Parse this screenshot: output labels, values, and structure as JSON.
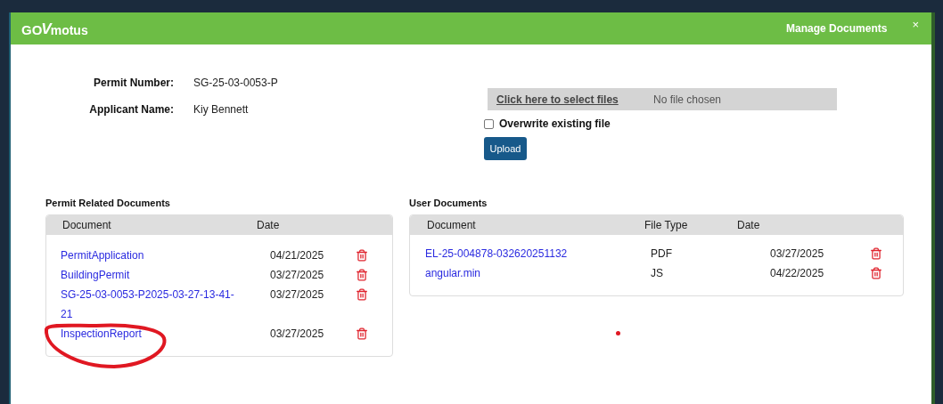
{
  "header": {
    "logo": {
      "prefix": "GO",
      "mark": "V",
      "suffix": "motus"
    },
    "title": "Manage Documents",
    "close": "×"
  },
  "permit_info": [
    {
      "label": "Permit Number:",
      "value": "SG-25-03-0053-P"
    },
    {
      "label": "Applicant Name:",
      "value": "Kiy Bennett"
    }
  ],
  "upload": {
    "select_link": "Click here to select files",
    "file_status": "No file chosen",
    "overwrite": {
      "label": "Overwrite existing file",
      "checked": false
    },
    "button": "Upload"
  },
  "permit_documents": {
    "title": "Permit Related Documents",
    "columns": [
      "Document",
      "Date"
    ],
    "rows": [
      {
        "document": "PermitApplication",
        "date": "04/21/2025"
      },
      {
        "document": "BuildingPermit",
        "date": "03/27/2025"
      },
      {
        "document": "SG-25-03-0053-P2025-03-27-13-41-21",
        "date": "03/27/2025"
      },
      {
        "document": "InspectionReport",
        "date": "03/27/2025"
      }
    ]
  },
  "user_documents": {
    "title": "User Documents",
    "columns": [
      "Document",
      "File Type",
      "Date"
    ],
    "rows": [
      {
        "document": "EL-25-004878-032620251132",
        "file_type": "PDF",
        "date": "03/27/2025"
      },
      {
        "document": "angular.min",
        "file_type": "JS",
        "date": "04/22/2025"
      }
    ]
  }
}
